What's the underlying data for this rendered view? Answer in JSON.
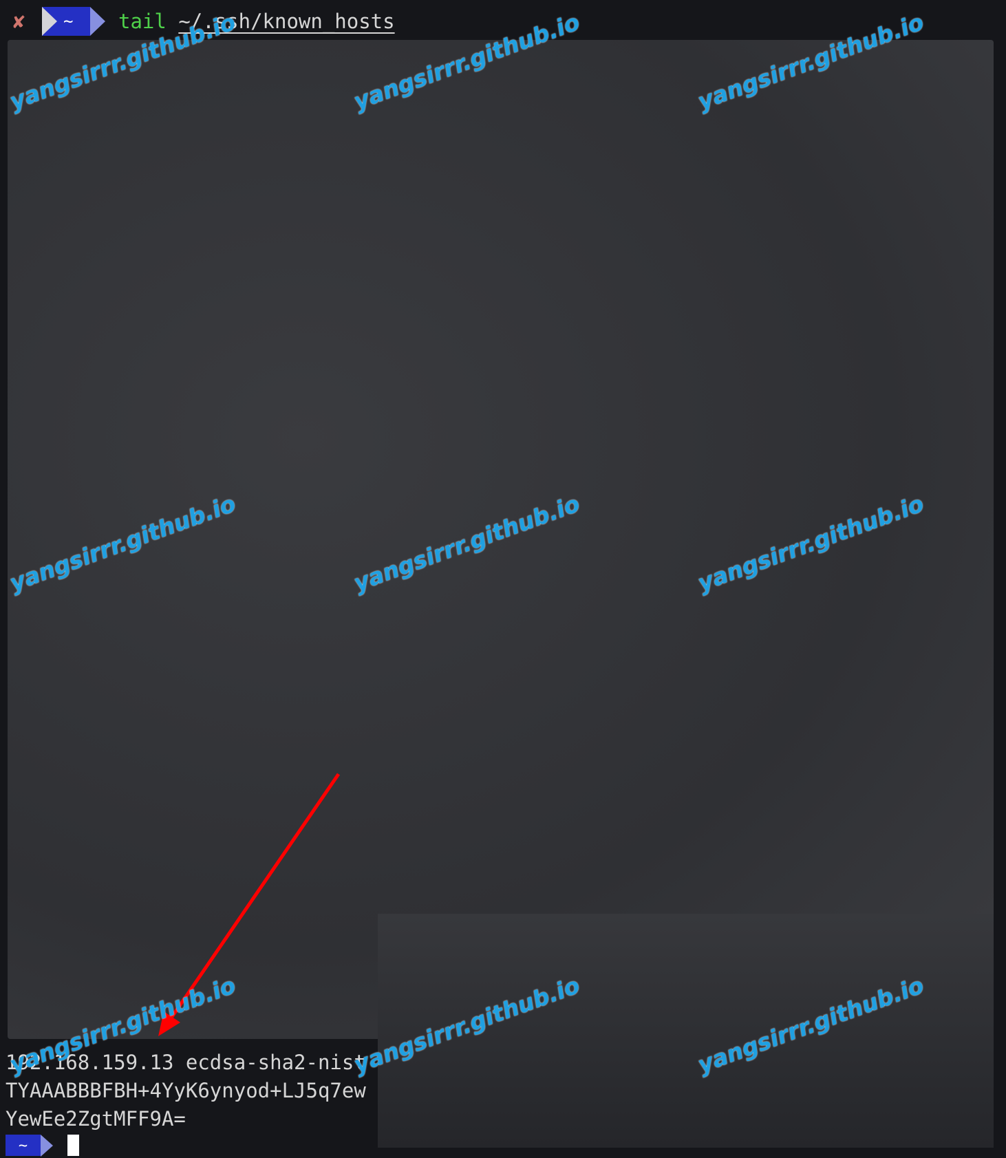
{
  "prompt": {
    "status_icon": "x-icon",
    "status": "✘",
    "dir": "~",
    "command": "tail",
    "argument": "~/.ssh/known_hosts"
  },
  "output_lines": [
    "192.168.159.13 ecdsa-sha2-nist",
    "TYAAABBBFBH+4YyK6ynyod+LJ5q7ew",
    "YewEe2ZgtMFF9A="
  ],
  "prompt2": {
    "dir": "~"
  },
  "watermark": "yangsirrr.github.io",
  "colors": {
    "accent": "#2430c4",
    "command": "#4fd14a",
    "watermark": "#1fa0e2",
    "annotation_arrow": "#ff0000"
  }
}
